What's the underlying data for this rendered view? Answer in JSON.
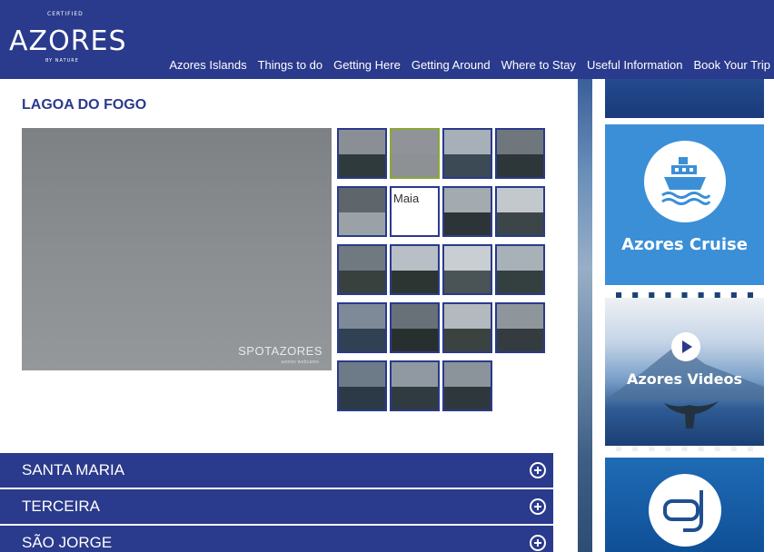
{
  "header": {
    "logo": {
      "word": "AZORES",
      "top_text": "CERTIFIED",
      "bottom_text": "BY NATURE"
    },
    "nav": [
      {
        "label": "Azores Islands"
      },
      {
        "label": "Things to do"
      },
      {
        "label": "Getting Here"
      },
      {
        "label": "Getting Around"
      },
      {
        "label": "Where to Stay"
      },
      {
        "label": "Useful Information"
      },
      {
        "label": "Book Your Trip"
      }
    ]
  },
  "main": {
    "section_title": "LAGOA DO FOGO",
    "webcam": {
      "brand": "SPOTAZORES",
      "brand_sub": "azores webcams"
    },
    "thumbnails": [
      {
        "sky": "#8a8f96",
        "land": "#2f3a3c",
        "active": false
      },
      {
        "sky": "#909498",
        "land": "#8d9194",
        "active": true
      },
      {
        "sky": "#a7afb8",
        "land": "#3b4a55",
        "active": false
      },
      {
        "sky": "#6f777d",
        "land": "#2d3639",
        "active": false
      },
      {
        "sky": "#5e656b",
        "land": "#9aa2a8",
        "active": false
      },
      {
        "broken": true,
        "alt": "Maia"
      },
      {
        "sky": "#a3aab0",
        "land": "#2c3437",
        "active": false
      },
      {
        "sky": "#c2c8cc",
        "land": "#3c4548",
        "active": false
      },
      {
        "sky": "#707880",
        "land": "#39413f",
        "active": false
      },
      {
        "sky": "#b8bfc6",
        "land": "#2d3532",
        "active": false
      },
      {
        "sky": "#c9ced2",
        "land": "#4a5356",
        "active": false
      },
      {
        "sky": "#a9b1b8",
        "land": "#34403f",
        "active": false
      },
      {
        "sky": "#7f8a98",
        "land": "#2f4152",
        "active": false
      },
      {
        "sky": "#687078",
        "land": "#28302f",
        "active": false
      },
      {
        "sky": "#b3b9be",
        "land": "#3a433f",
        "active": false
      },
      {
        "sky": "#8e969c",
        "land": "#343c3f",
        "active": false
      },
      {
        "sky": "#6d7a88",
        "land": "#2b3a46",
        "active": false
      },
      {
        "sky": "#9099a1",
        "land": "#303b41",
        "active": false
      },
      {
        "sky": "#8b939b",
        "land": "#2e383c",
        "active": false
      }
    ],
    "accordion": [
      {
        "label": "SANTA MARIA"
      },
      {
        "label": "TERCEIRA"
      },
      {
        "label": "SÃO JORGE"
      }
    ]
  },
  "sidebar": {
    "cruise_label": "Azores Cruise",
    "videos_label": "Azores Videos"
  }
}
